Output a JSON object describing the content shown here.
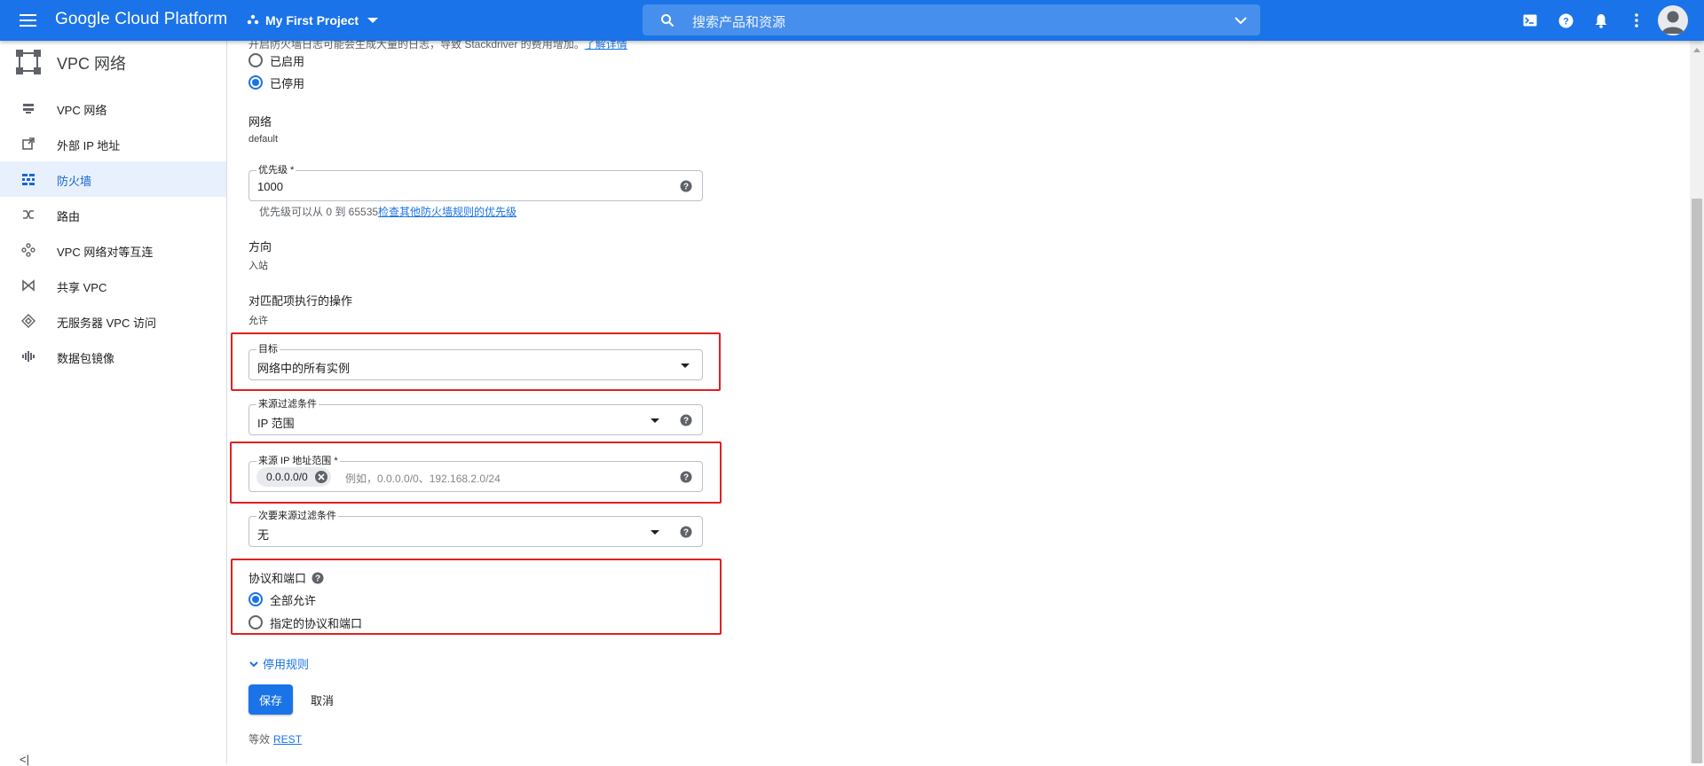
{
  "topbar": {
    "app_title": "Google Cloud Platform",
    "project_name": "My First Project",
    "search_placeholder": "搜索产品和资源"
  },
  "sidebar": {
    "title": "VPC 网络",
    "items": [
      {
        "label": "VPC 网络",
        "icon": "vpc-network-icon"
      },
      {
        "label": "外部 IP 地址",
        "icon": "external-ip-icon"
      },
      {
        "label": "防火墙",
        "icon": "firewall-icon",
        "active": true
      },
      {
        "label": "路由",
        "icon": "routes-icon"
      },
      {
        "label": "VPC 网络对等互连",
        "icon": "peering-icon"
      },
      {
        "label": "共享 VPC",
        "icon": "shared-vpc-icon"
      },
      {
        "label": "无服务器 VPC 访问",
        "icon": "serverless-icon"
      },
      {
        "label": "数据包镜像",
        "icon": "packet-mirroring-icon"
      }
    ],
    "collapse_label": "<|"
  },
  "form": {
    "clipped_text_prefix": "开启防火墙日志可能会生成大量的日志，导致 Stackdriver 的费用增加。",
    "clipped_link": "了解详情",
    "logs_options": [
      "已启用",
      "已停用"
    ],
    "logs_selected": "已停用",
    "network_label": "网络",
    "network_value": "default",
    "priority_label": "优先级 *",
    "priority_value": "1000",
    "priority_hint": "优先级可以从 0 到 65535",
    "priority_hint_link": "检查其他防火墙规则的优先级",
    "direction_label": "方向",
    "direction_value": "入站",
    "action_label": "对匹配项执行的操作",
    "action_value": "允许",
    "target_label": "目标",
    "target_value": "网络中的所有实例",
    "source_filter_label": "来源过滤条件",
    "source_filter_value": "IP 范围",
    "source_ip_label": "来源 IP 地址范围 *",
    "source_ip_chip": "0.0.0.0/0",
    "source_ip_placeholder": "例如，0.0.0.0/0、192.168.2.0/24",
    "secondary_filter_label": "次要来源过滤条件",
    "secondary_filter_value": "无",
    "protocols_label": "协议和端口",
    "protocol_options": [
      "全部允许",
      "指定的协议和端口"
    ],
    "protocol_selected": "全部允许",
    "disable_rule_label": "停用规则",
    "save_label": "保存",
    "cancel_label": "取消",
    "equivalent_label": "等效",
    "equivalent_link": "REST"
  },
  "colors": {
    "brand_blue": "#1a73e8",
    "highlight_red": "#e02020",
    "active_bg": "#e8f0fe"
  }
}
